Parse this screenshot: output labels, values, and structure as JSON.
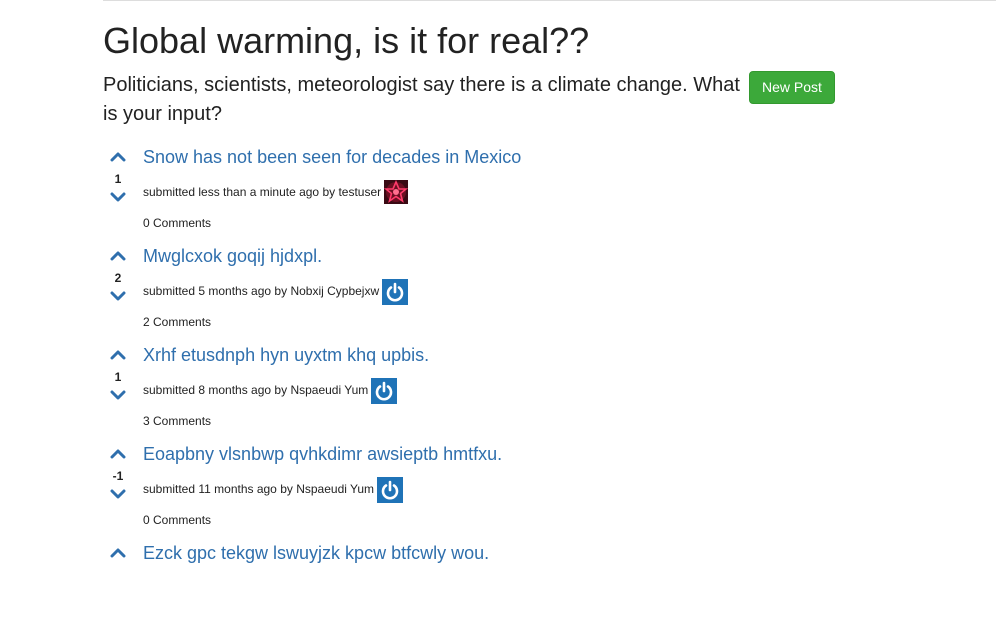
{
  "page": {
    "title": "Global warming, is it for real??",
    "subtitle": "Politicians, scientists, meteorologist say there is a climate change. What is your input?",
    "new_post_label": "New Post"
  },
  "colors": {
    "accent_link": "#2f6fad",
    "button_green": "#3ca93a",
    "avatar_power_blue": "#1f73b7"
  },
  "posts": [
    {
      "score": "1",
      "title": "Snow has not been seen for decades in Mexico",
      "submitted": "submitted less than a minute ago by",
      "author": "testuser",
      "avatar": "star-avatar-icon",
      "comments": "0 Comments"
    },
    {
      "score": "2",
      "title": "Mwglcxok goqij hjdxpl.",
      "submitted": "submitted 5 months ago by",
      "author": "Nobxij Cypbejxw",
      "avatar": "power-avatar-icon",
      "comments": "2 Comments"
    },
    {
      "score": "1",
      "title": "Xrhf etusdnph hyn uyxtm khq upbis.",
      "submitted": "submitted 8 months ago by",
      "author": "Nspaeudi Yum",
      "avatar": "power-avatar-icon",
      "comments": "3 Comments"
    },
    {
      "score": "-1",
      "title": "Eoapbny vlsnbwp qvhkdimr awsieptb hmtfxu.",
      "submitted": "submitted 11 months ago by",
      "author": "Nspaeudi Yum",
      "avatar": "power-avatar-icon",
      "comments": "0 Comments"
    },
    {
      "score": "",
      "title": "Ezck gpc tekgw lswuyjzk kpcw btfcwly wou.",
      "submitted": "",
      "author": "",
      "avatar": "",
      "comments": ""
    }
  ]
}
